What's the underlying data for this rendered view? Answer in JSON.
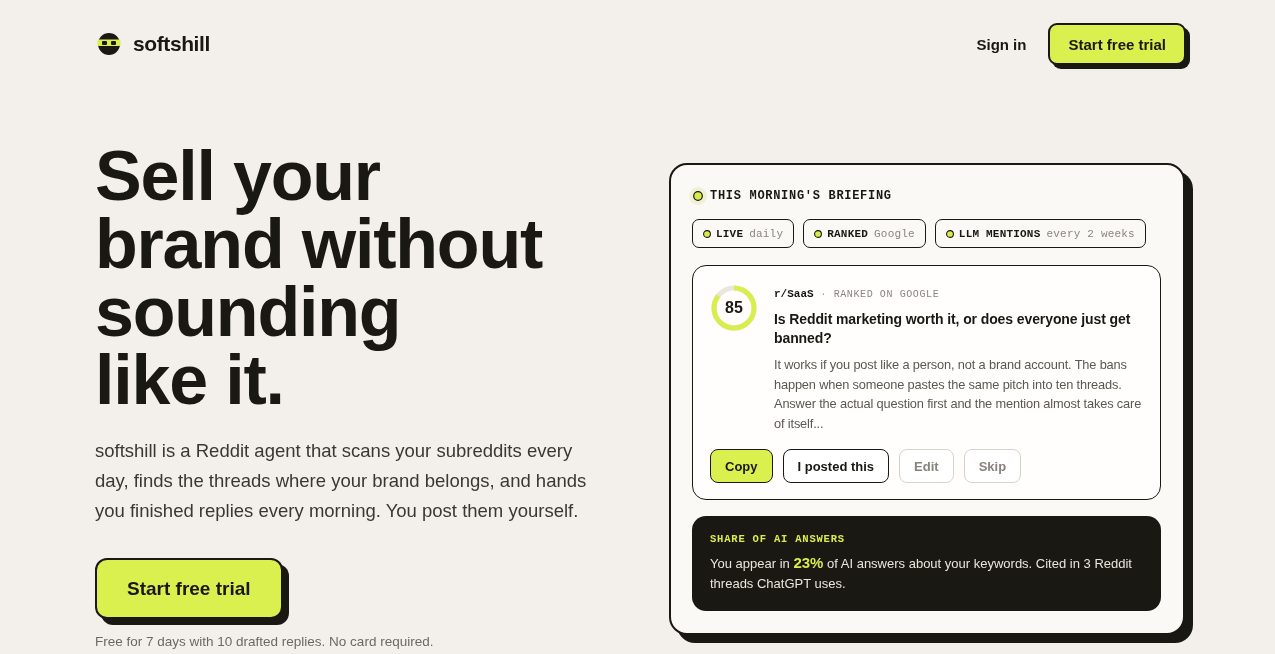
{
  "header": {
    "brand": "softshill",
    "nav": [
      {
        "label": "Sign in",
        "kind": "link"
      },
      {
        "label": "Start free trial",
        "kind": "button"
      }
    ]
  },
  "hero": {
    "headline_lines": [
      "Sell your",
      "brand without",
      "sounding",
      "like it."
    ],
    "description": "softshill is a Reddit agent that scans your subreddits every day, finds the threads where your brand belongs, and hands you finished replies every morning. You post them yourself.",
    "cta": "Start free trial",
    "note": "Free for 7 days with 10 drafted replies. No card required."
  },
  "briefing": {
    "title": "THIS MORNING'S BRIEFING",
    "tags": [
      {
        "label": "LIVE",
        "value": "daily"
      },
      {
        "label": "RANKED",
        "value": "Google"
      },
      {
        "label": "LLM MENTIONS",
        "value": "every 2 weeks"
      }
    ],
    "thread": {
      "score": {
        "value": "85",
        "level": 0.85
      },
      "subreddit": "r/SaaS",
      "separator": "·",
      "status": "RANKED ON GOOGLE",
      "title": "Is Reddit marketing worth it, or does everyone just get banned?",
      "excerpt": "It works if you post like a person, not a brand account. The bans happen when someone pastes the same pitch into ten threads. Answer the actual question first and the mention almost takes care of itself...",
      "actions": [
        {
          "label": "Copy",
          "kind": "primary"
        },
        {
          "label": "I posted this",
          "kind": "secondary"
        },
        {
          "label": "Edit",
          "kind": "ghost"
        },
        {
          "label": "Skip",
          "kind": "ghost"
        }
      ]
    },
    "share": {
      "label": "SHARE OF AI ANSWERS",
      "text": "You appear in **23%** of AI answers about your keywords. Cited in 3 Reddit threads ChatGPT uses."
    }
  }
}
